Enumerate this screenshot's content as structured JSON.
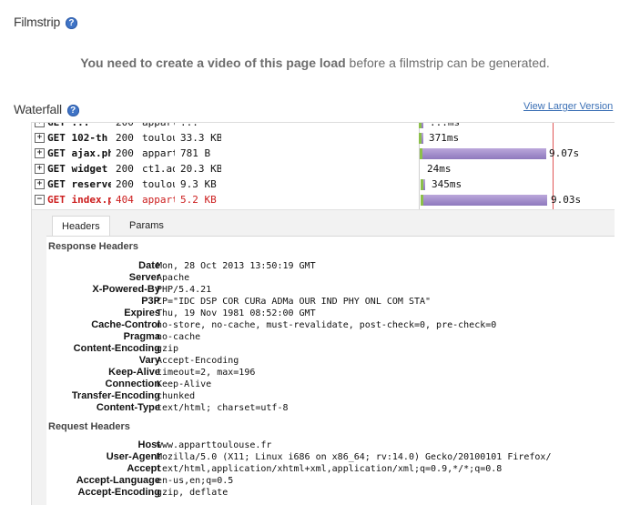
{
  "filmstrip": {
    "title": "Filmstrip",
    "message_bold": "You need to create a video of this page load",
    "message_rest": " before a filmstrip can be generated."
  },
  "waterfall": {
    "title": "Waterfall",
    "view_larger": "View Larger Version",
    "rows": [
      {
        "url": "GET 102-th",
        "status": "200",
        "host": "toulou",
        "size": "33.3 KB",
        "time": "371ms",
        "expander": "+"
      },
      {
        "url": "GET ajax.ph",
        "status": "200",
        "host": "appart",
        "size": "781 B",
        "time": "9.07s",
        "expander": "+"
      },
      {
        "url": "GET widget",
        "status": "200",
        "host": "ct1.ad",
        "size": "20.3 KB",
        "time": "24ms",
        "expander": "+"
      },
      {
        "url": "GET reserve",
        "status": "200",
        "host": "toulou",
        "size": "9.3 KB",
        "time": "345ms",
        "expander": "+"
      },
      {
        "url": "GET index.p",
        "status": "404",
        "host": "appart",
        "size": "5.2 KB",
        "time": "9.03s",
        "expander": "−"
      }
    ],
    "partial_row": {
      "url": "GET ...",
      "status": "200",
      "host": "appart",
      "size": "...",
      "time": "...ms"
    }
  },
  "details": {
    "tabs": [
      "Headers",
      "Params"
    ],
    "active_tab": "Headers",
    "response_title": "Response Headers",
    "response_headers": [
      {
        "k": "Date",
        "v": "Mon, 28 Oct 2013 13:50:19 GMT"
      },
      {
        "k": "Server",
        "v": "Apache"
      },
      {
        "k": "X-Powered-By",
        "v": "PHP/5.4.21"
      },
      {
        "k": "P3P",
        "v": "CP=\"IDC DSP COR CURa ADMa OUR IND PHY ONL COM STA\""
      },
      {
        "k": "Expires",
        "v": "Thu, 19 Nov 1981 08:52:00 GMT"
      },
      {
        "k": "Cache-Control",
        "v": "no-store, no-cache, must-revalidate, post-check=0, pre-check=0"
      },
      {
        "k": "Pragma",
        "v": "no-cache"
      },
      {
        "k": "Content-Encoding",
        "v": "gzip"
      },
      {
        "k": "Vary",
        "v": "Accept-Encoding"
      },
      {
        "k": "Keep-Alive",
        "v": "timeout=2, max=196"
      },
      {
        "k": "Connection",
        "v": "Keep-Alive"
      },
      {
        "k": "Transfer-Encoding",
        "v": "chunked"
      },
      {
        "k": "Content-Type",
        "v": "text/html; charset=utf-8"
      }
    ],
    "request_title": "Request Headers",
    "request_headers": [
      {
        "k": "Host",
        "v": "www.apparttoulouse.fr"
      },
      {
        "k": "User-Agent",
        "v": "Mozilla/5.0 (X11; Linux i686 on x86_64; rv:14.0) Gecko/20100101 Firefox/"
      },
      {
        "k": "Accept",
        "v": "text/html,application/xhtml+xml,application/xml;q=0.9,*/*;q=0.8"
      },
      {
        "k": "Accept-Language",
        "v": "en-us,en;q=0.5"
      },
      {
        "k": "Accept-Encoding",
        "v": "gzip, deflate"
      }
    ]
  },
  "colors": {
    "link": "#3a6fb5",
    "error": "#cc1d1d",
    "bar": "#9b87c8",
    "bar_start": "#8cc04a",
    "load_line": "#e05555"
  }
}
